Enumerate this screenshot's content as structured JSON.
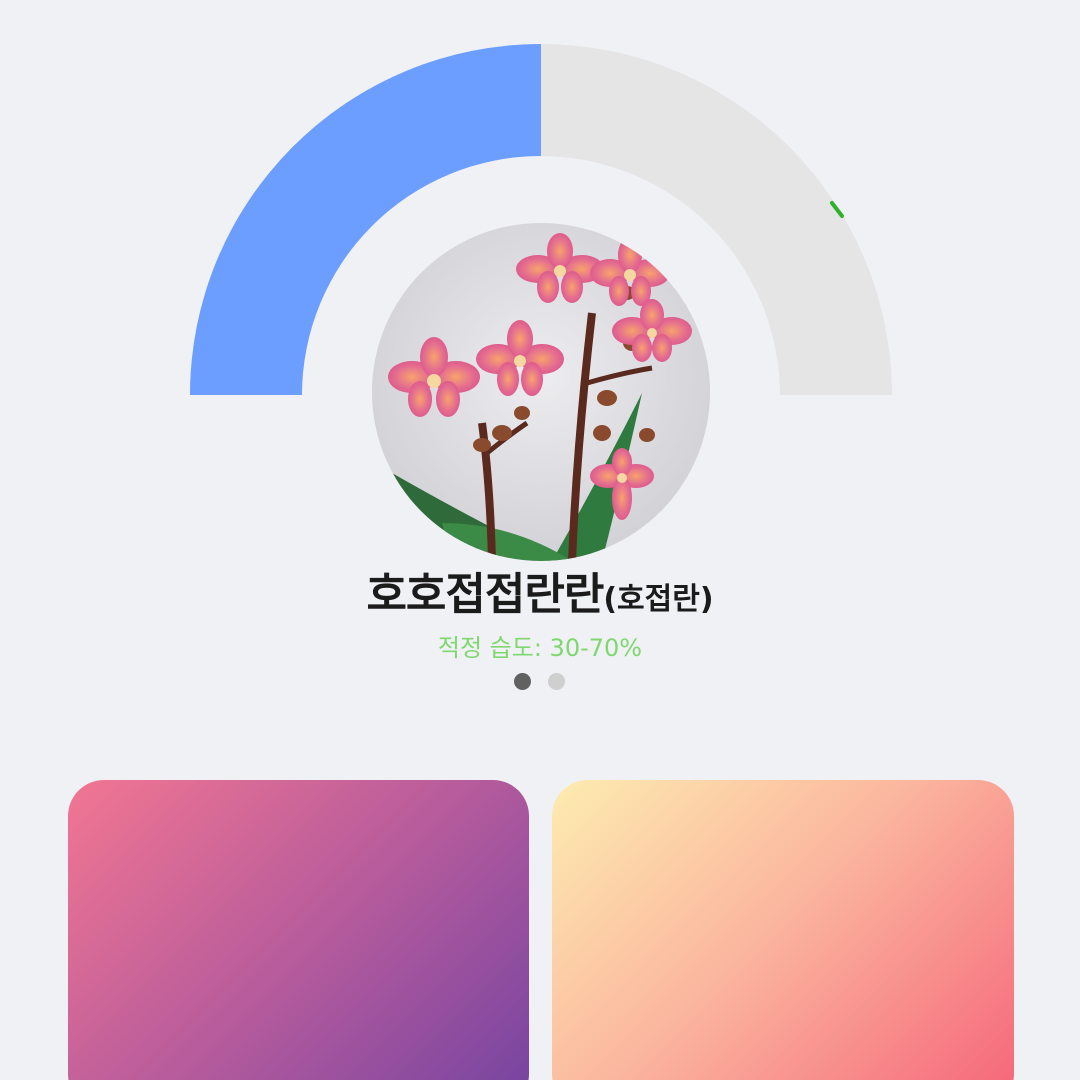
{
  "gauge": {
    "fill_fraction": 0.5,
    "fill_color": "#6b9eff",
    "track_color": "#e5e5e5",
    "marker_color": "#2fb12c"
  },
  "plant": {
    "name_main": "호호접접란란",
    "name_sub": "(호접란)",
    "humidity_text": "적정 습도: 30-70%",
    "photo_icon": "orchid-photo"
  },
  "pager": {
    "count": 2,
    "active_index": 0
  },
  "cards": [
    {
      "name": "pink-purple-card",
      "gradient": [
        "#f27692",
        "#7443a1"
      ]
    },
    {
      "name": "yellow-coral-card",
      "gradient": [
        "#fdecb0",
        "#f56479"
      ]
    }
  ]
}
